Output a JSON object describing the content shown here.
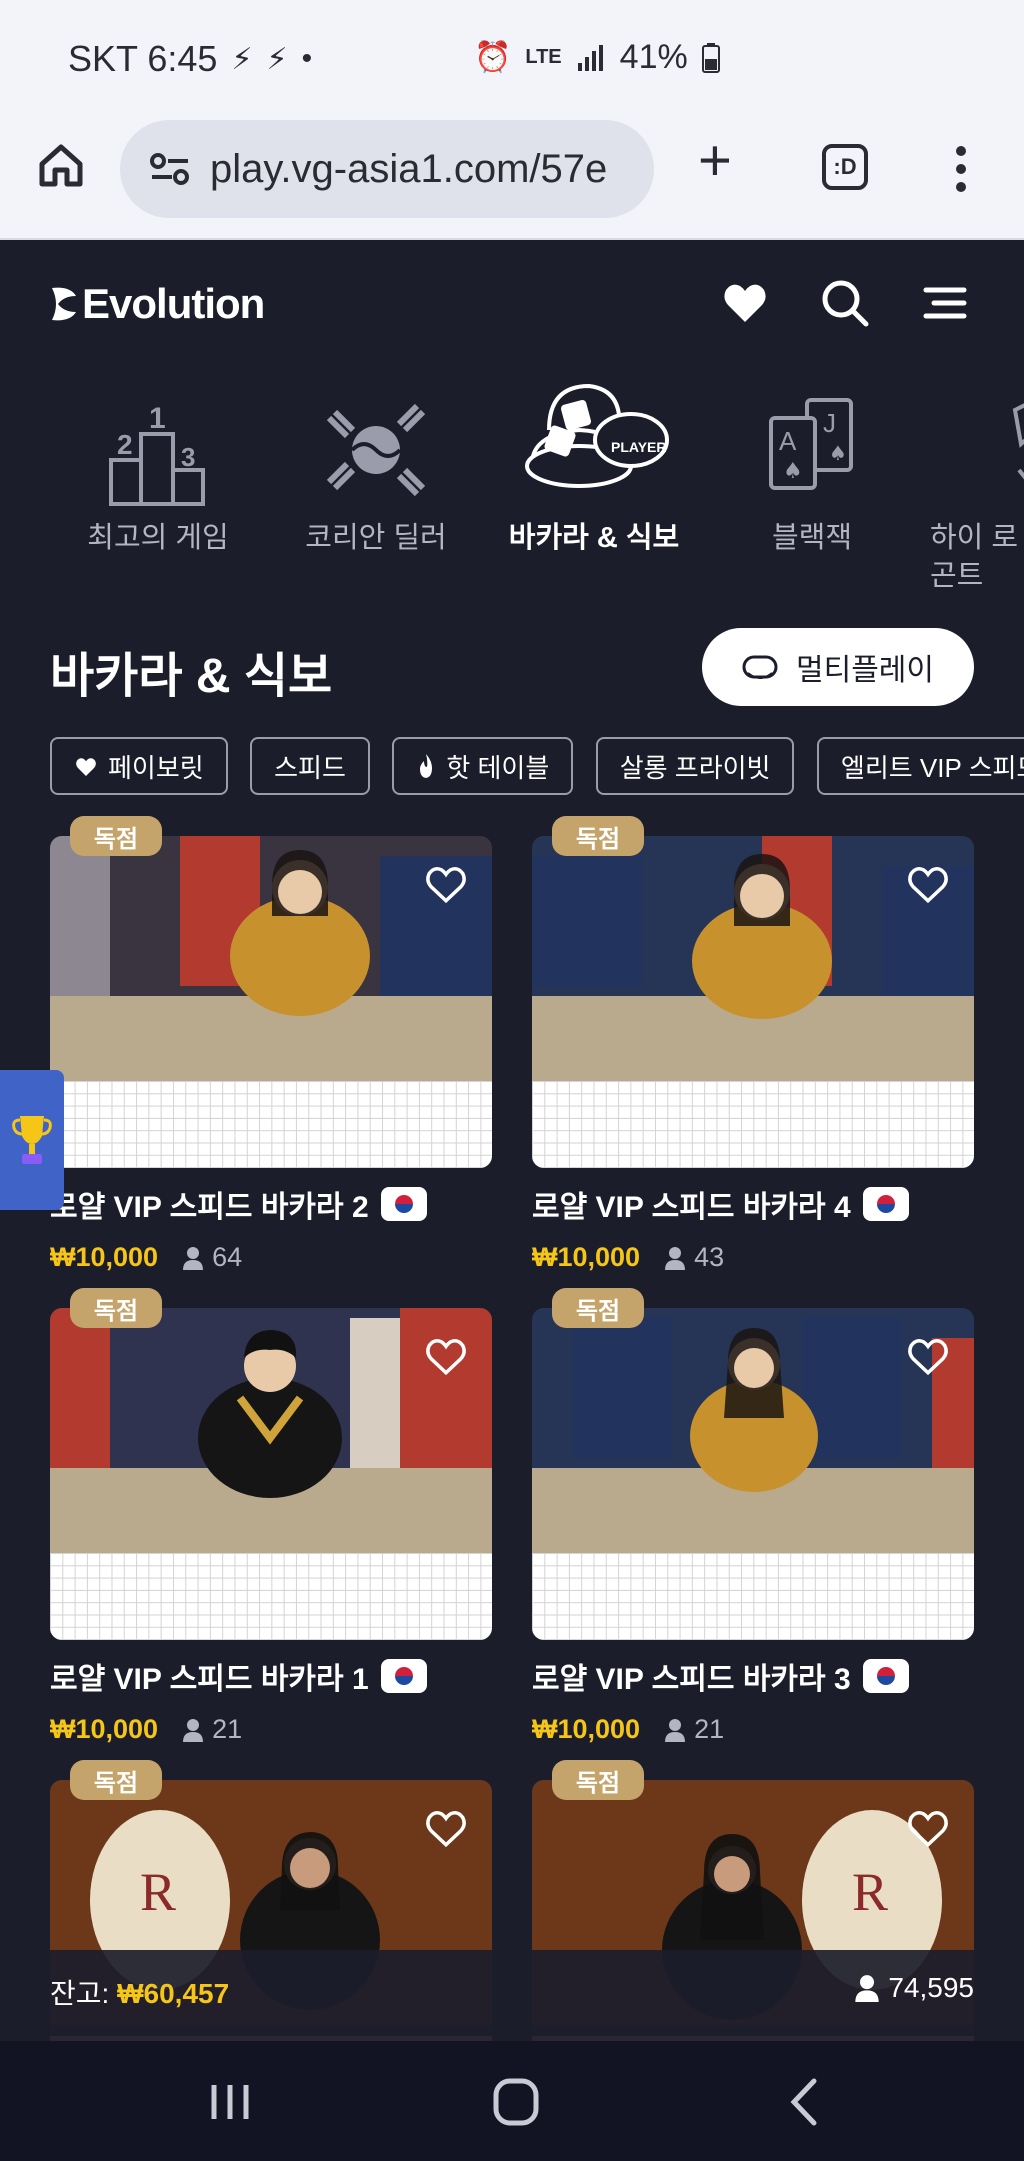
{
  "status_bar": {
    "carrier_time": "SKT 6:45",
    "network": "LTE",
    "battery": "41%"
  },
  "browser": {
    "url": "play.vg-asia1.com/57e",
    "tabs_label": ":D"
  },
  "app": {
    "logo_text": "Evolution"
  },
  "categories": [
    {
      "label": "최고의 게임",
      "icon": "podium-icon",
      "active": false
    },
    {
      "label": "코리안 딜러",
      "icon": "korean-trigram-icon",
      "active": false
    },
    {
      "label": "바카라 & 식보",
      "icon": "dice-chip-icon",
      "active": true
    },
    {
      "label": "블랙잭",
      "icon": "playing-cards-icon",
      "active": false
    },
    {
      "label": "하이 로\n곤트",
      "icon": "hi-lo-icon",
      "active": false
    }
  ],
  "section": {
    "title": "바카라 & 식보",
    "multiplay_label": "멀티플레이"
  },
  "filters": [
    "페이보릿",
    "스피드",
    "핫 테이블",
    "살롱 프라이빗",
    "엘리트 VIP 스피드"
  ],
  "badge_label": "독점",
  "tables": [
    {
      "name": "로얄 VIP 스피드 바카라 2",
      "price": "₩10,000",
      "players": "64"
    },
    {
      "name": "로얄 VIP 스피드 바카라 4",
      "price": "₩10,000",
      "players": "43"
    },
    {
      "name": "로얄 VIP 스피드 바카라 1",
      "price": "₩10,000",
      "players": "21"
    },
    {
      "name": "로얄 VIP 스피드 바카라 3",
      "price": "₩10,000",
      "players": "21"
    },
    {
      "name": "",
      "price": "",
      "players": ""
    },
    {
      "name": "",
      "price": "",
      "players": ""
    }
  ],
  "balance": {
    "label": "잔고:",
    "value": "₩60,457",
    "total_players": "74,595"
  },
  "colors": {
    "background": "#1c1d2b",
    "accent_gold": "#f5c518",
    "badge": "#c4a46a",
    "trophy_tab": "#3f63c6"
  }
}
